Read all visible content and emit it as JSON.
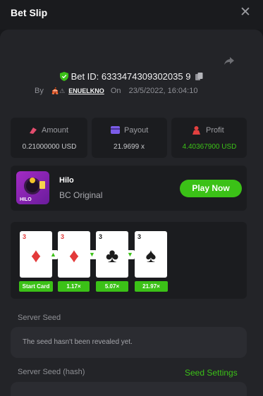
{
  "header": {
    "title": "Bet Slip",
    "close_icon": "close-icon"
  },
  "bet": {
    "id_label": "Bet ID: 6333474309302035 9",
    "by_label": "By",
    "username": "ENUELKNO",
    "on_label": "On",
    "timestamp": "23/5/2022, 16:04:10"
  },
  "stats": {
    "amount": {
      "label": "Amount",
      "value": "0.21000000 USD"
    },
    "payout": {
      "label": "Payout",
      "value": "21.9699 x"
    },
    "profit": {
      "label": "Profit",
      "value": "4.40367900 USD"
    }
  },
  "game": {
    "name": "Hilo",
    "subtitle": "BC Original",
    "icon_text": "HILO",
    "play_label": "Play Now"
  },
  "cards": [
    {
      "rank": "3",
      "suit": "♦",
      "color": "red",
      "chip": "Start Card"
    },
    {
      "rank": "3",
      "suit": "♦",
      "color": "red",
      "chip": "1.17×",
      "arrow": "▲"
    },
    {
      "rank": "3",
      "suit": "♣",
      "color": "black",
      "chip": "5.07×",
      "arrow": "▼"
    },
    {
      "rank": "3",
      "suit": "♠",
      "color": "black",
      "chip": "21.97×",
      "arrow": "▼"
    }
  ],
  "server_seed": {
    "label": "Server Seed",
    "value": "The seed hasn't been revealed yet."
  },
  "server_seed_hash": {
    "label": "Server Seed (hash)",
    "settings_link": "Seed Settings"
  },
  "colors": {
    "accent_green": "#3bc117",
    "bg": "#17181b",
    "panel": "#232428"
  }
}
